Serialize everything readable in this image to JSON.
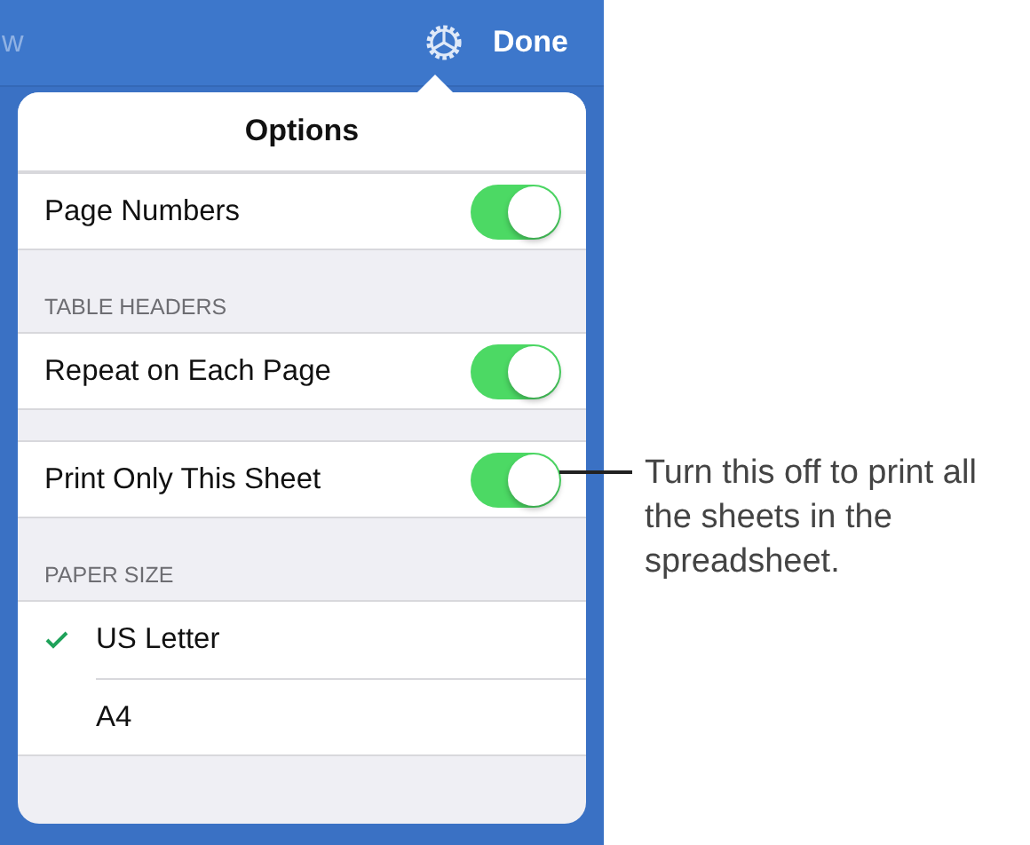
{
  "top_bar": {
    "back_fragment": "w",
    "done": "Done"
  },
  "popover": {
    "title": "Options",
    "sections": [
      {
        "rows": [
          {
            "kind": "toggle",
            "label": "Page Numbers",
            "on": true
          }
        ]
      },
      {
        "header": "TABLE HEADERS",
        "rows": [
          {
            "kind": "toggle",
            "label": "Repeat on Each Page",
            "on": true
          }
        ]
      },
      {
        "rows": [
          {
            "kind": "toggle",
            "label": "Print Only This Sheet",
            "on": true
          }
        ]
      },
      {
        "header": "PAPER SIZE",
        "rows": [
          {
            "kind": "choice",
            "label": "US Letter",
            "selected": true
          },
          {
            "kind": "choice",
            "label": "A4",
            "selected": false
          }
        ]
      }
    ]
  },
  "callout": {
    "text": "Turn this off to print all the sheets in the spreadsheet."
  }
}
